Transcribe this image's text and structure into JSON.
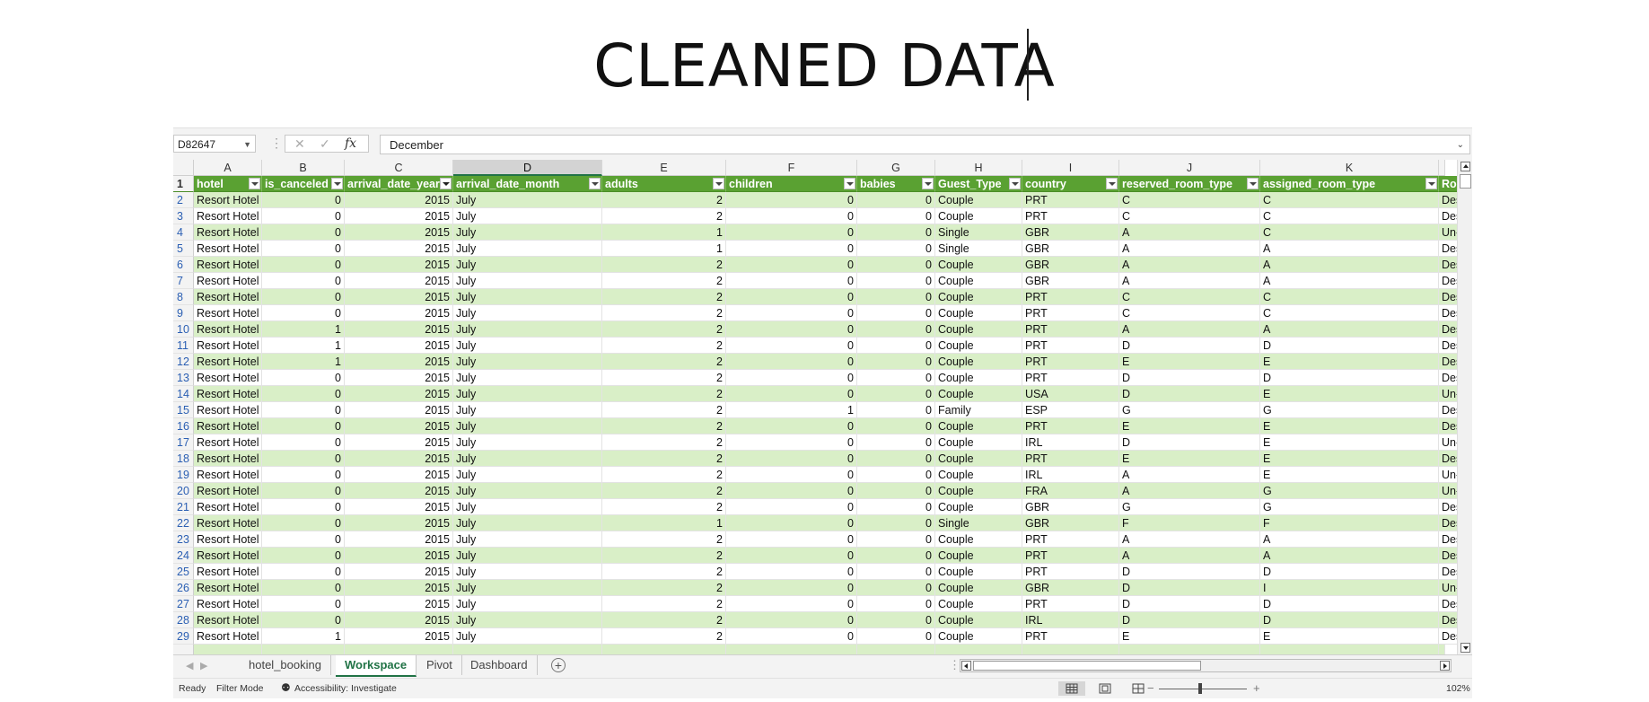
{
  "slide": {
    "title": "CLEANED DATA"
  },
  "formula_bar": {
    "name_box": "D82647",
    "cancel_icon": "✕",
    "enter_icon": "✓",
    "fx_label": "fx",
    "formula": "December"
  },
  "column_letters": [
    "A",
    "B",
    "C",
    "D",
    "E",
    "F",
    "G",
    "H",
    "I",
    "J",
    "K",
    ""
  ],
  "selected_column": "D",
  "header_row_number": "1",
  "headers": [
    "hotel",
    "is_canceled",
    "arrival_date_year",
    "arrival_date_month",
    "adults",
    "children",
    "babies",
    "Guest_Type",
    "country",
    "reserved_room_type",
    "assigned_room_type",
    "Room_St"
  ],
  "rows": [
    {
      "n": "2",
      "c": [
        "Resort Hotel",
        "0",
        "2015",
        "July",
        "2",
        "0",
        "0",
        "Couple",
        "PRT",
        "C",
        "C",
        "Desired"
      ]
    },
    {
      "n": "3",
      "c": [
        "Resort Hotel",
        "0",
        "2015",
        "July",
        "2",
        "0",
        "0",
        "Couple",
        "PRT",
        "C",
        "C",
        "Desired"
      ]
    },
    {
      "n": "4",
      "c": [
        "Resort Hotel",
        "0",
        "2015",
        "July",
        "1",
        "0",
        "0",
        "Single",
        "GBR",
        "A",
        "C",
        "Un-Desir"
      ]
    },
    {
      "n": "5",
      "c": [
        "Resort Hotel",
        "0",
        "2015",
        "July",
        "1",
        "0",
        "0",
        "Single",
        "GBR",
        "A",
        "A",
        "Desired"
      ]
    },
    {
      "n": "6",
      "c": [
        "Resort Hotel",
        "0",
        "2015",
        "July",
        "2",
        "0",
        "0",
        "Couple",
        "GBR",
        "A",
        "A",
        "Desired"
      ]
    },
    {
      "n": "7",
      "c": [
        "Resort Hotel",
        "0",
        "2015",
        "July",
        "2",
        "0",
        "0",
        "Couple",
        "GBR",
        "A",
        "A",
        "Desired"
      ]
    },
    {
      "n": "8",
      "c": [
        "Resort Hotel",
        "0",
        "2015",
        "July",
        "2",
        "0",
        "0",
        "Couple",
        "PRT",
        "C",
        "C",
        "Desired"
      ]
    },
    {
      "n": "9",
      "c": [
        "Resort Hotel",
        "0",
        "2015",
        "July",
        "2",
        "0",
        "0",
        "Couple",
        "PRT",
        "C",
        "C",
        "Desired"
      ]
    },
    {
      "n": "10",
      "c": [
        "Resort Hotel",
        "1",
        "2015",
        "July",
        "2",
        "0",
        "0",
        "Couple",
        "PRT",
        "A",
        "A",
        "Desired"
      ]
    },
    {
      "n": "11",
      "c": [
        "Resort Hotel",
        "1",
        "2015",
        "July",
        "2",
        "0",
        "0",
        "Couple",
        "PRT",
        "D",
        "D",
        "Desired"
      ]
    },
    {
      "n": "12",
      "c": [
        "Resort Hotel",
        "1",
        "2015",
        "July",
        "2",
        "0",
        "0",
        "Couple",
        "PRT",
        "E",
        "E",
        "Desired"
      ]
    },
    {
      "n": "13",
      "c": [
        "Resort Hotel",
        "0",
        "2015",
        "July",
        "2",
        "0",
        "0",
        "Couple",
        "PRT",
        "D",
        "D",
        "Desired"
      ]
    },
    {
      "n": "14",
      "c": [
        "Resort Hotel",
        "0",
        "2015",
        "July",
        "2",
        "0",
        "0",
        "Couple",
        "USA",
        "D",
        "E",
        "Un-Desir"
      ]
    },
    {
      "n": "15",
      "c": [
        "Resort Hotel",
        "0",
        "2015",
        "July",
        "2",
        "1",
        "0",
        "Family",
        "ESP",
        "G",
        "G",
        "Desired"
      ]
    },
    {
      "n": "16",
      "c": [
        "Resort Hotel",
        "0",
        "2015",
        "July",
        "2",
        "0",
        "0",
        "Couple",
        "PRT",
        "E",
        "E",
        "Desired"
      ]
    },
    {
      "n": "17",
      "c": [
        "Resort Hotel",
        "0",
        "2015",
        "July",
        "2",
        "0",
        "0",
        "Couple",
        "IRL",
        "D",
        "E",
        "Un-Desir"
      ]
    },
    {
      "n": "18",
      "c": [
        "Resort Hotel",
        "0",
        "2015",
        "July",
        "2",
        "0",
        "0",
        "Couple",
        "PRT",
        "E",
        "E",
        "Desired"
      ]
    },
    {
      "n": "19",
      "c": [
        "Resort Hotel",
        "0",
        "2015",
        "July",
        "2",
        "0",
        "0",
        "Couple",
        "IRL",
        "A",
        "E",
        "Un-Desir"
      ]
    },
    {
      "n": "20",
      "c": [
        "Resort Hotel",
        "0",
        "2015",
        "July",
        "2",
        "0",
        "0",
        "Couple",
        "FRA",
        "A",
        "G",
        "Un-Desir"
      ]
    },
    {
      "n": "21",
      "c": [
        "Resort Hotel",
        "0",
        "2015",
        "July",
        "2",
        "0",
        "0",
        "Couple",
        "GBR",
        "G",
        "G",
        "Desired"
      ]
    },
    {
      "n": "22",
      "c": [
        "Resort Hotel",
        "0",
        "2015",
        "July",
        "1",
        "0",
        "0",
        "Single",
        "GBR",
        "F",
        "F",
        "Desired"
      ]
    },
    {
      "n": "23",
      "c": [
        "Resort Hotel",
        "0",
        "2015",
        "July",
        "2",
        "0",
        "0",
        "Couple",
        "PRT",
        "A",
        "A",
        "Desired"
      ]
    },
    {
      "n": "24",
      "c": [
        "Resort Hotel",
        "0",
        "2015",
        "July",
        "2",
        "0",
        "0",
        "Couple",
        "PRT",
        "A",
        "A",
        "Desired"
      ]
    },
    {
      "n": "25",
      "c": [
        "Resort Hotel",
        "0",
        "2015",
        "July",
        "2",
        "0",
        "0",
        "Couple",
        "PRT",
        "D",
        "D",
        "Desired"
      ]
    },
    {
      "n": "26",
      "c": [
        "Resort Hotel",
        "0",
        "2015",
        "July",
        "2",
        "0",
        "0",
        "Couple",
        "GBR",
        "D",
        "I",
        "Un-Desir"
      ]
    },
    {
      "n": "27",
      "c": [
        "Resort Hotel",
        "0",
        "2015",
        "July",
        "2",
        "0",
        "0",
        "Couple",
        "PRT",
        "D",
        "D",
        "Desired"
      ]
    },
    {
      "n": "28",
      "c": [
        "Resort Hotel",
        "0",
        "2015",
        "July",
        "2",
        "0",
        "0",
        "Couple",
        "IRL",
        "D",
        "D",
        "Desired"
      ]
    },
    {
      "n": "29",
      "c": [
        "Resort Hotel",
        "1",
        "2015",
        "July",
        "2",
        "0",
        "0",
        "Couple",
        "PRT",
        "E",
        "E",
        "Desired"
      ]
    }
  ],
  "sheet_tabs": [
    "hotel_booking",
    "Workspace",
    "Pivot",
    "Dashboard"
  ],
  "active_sheet": "Workspace",
  "add_sheet_icon": "+",
  "status_bar": {
    "ready": "Ready",
    "filter_mode": "Filter Mode",
    "accessibility": "Accessibility: Investigate",
    "zoom": "102%",
    "zoom_minus": "−",
    "zoom_plus": "+"
  },
  "colors": {
    "header_green": "#5aa132",
    "band_green": "#d9efc7",
    "excel_green": "#217346"
  },
  "icons": [
    "name-box-dropdown-icon",
    "cancel-icon",
    "enter-icon",
    "fx-icon",
    "formula-expand-icon",
    "filter-dropdown-icon",
    "scroll-up-icon",
    "scroll-down-icon",
    "scroll-left-icon",
    "scroll-right-icon",
    "add-sheet-icon",
    "accessibility-icon",
    "normal-view-icon",
    "page-layout-icon",
    "page-break-icon"
  ]
}
